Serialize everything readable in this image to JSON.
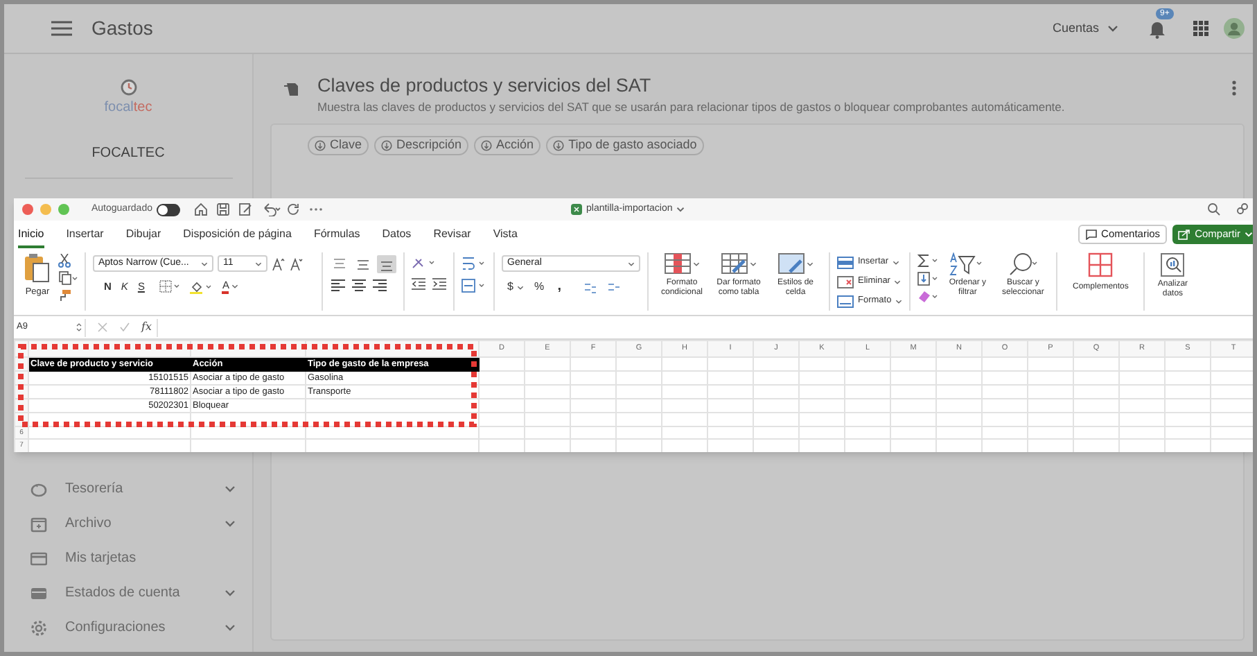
{
  "app": {
    "title": "Gastos",
    "account_menu": "Cuentas",
    "notification_badge": "9+"
  },
  "sidebar": {
    "logo_parts": [
      {
        "text": "focal",
        "color": "#7d8fae"
      },
      {
        "text": "tec",
        "color": "#c46a60"
      }
    ],
    "company": "FOCALTEC",
    "items": [
      {
        "label": "Tesorería",
        "expandable": true,
        "kind": "piggy"
      },
      {
        "label": "Archivo",
        "expandable": true,
        "kind": "archive"
      },
      {
        "label": "Mis tarjetas",
        "expandable": false,
        "kind": "card"
      },
      {
        "label": "Estados de cuenta",
        "expandable": true,
        "kind": "wallet"
      },
      {
        "label": "Configuraciones",
        "expandable": true,
        "kind": "gear"
      }
    ]
  },
  "page": {
    "title": "Claves de productos y servicios del SAT",
    "subtitle": "Muestra las claves de productos y servicios del SAT que se usarán para relacionar tipos de gastos o bloquear comprobantes automáticamente.",
    "filter_chips": [
      "Clave",
      "Descripción",
      "Acción",
      "Tipo de gasto asociado"
    ]
  },
  "excel": {
    "autosave_label": "Autoguardado",
    "autosave_on": false,
    "file_name": "plantilla-importacion",
    "tabs": [
      {
        "label": "Inicio",
        "selected": true
      },
      {
        "label": "Insertar",
        "selected": false
      },
      {
        "label": "Dibujar",
        "selected": false
      },
      {
        "label": "Disposición de página",
        "selected": false
      },
      {
        "label": "Fórmulas",
        "selected": false
      },
      {
        "label": "Datos",
        "selected": false
      },
      {
        "label": "Revisar",
        "selected": false
      },
      {
        "label": "Vista",
        "selected": false
      }
    ],
    "comments_button": "Comentarios",
    "share_button": "Compartir",
    "ribbon": {
      "paste": "Pegar",
      "font_name": "Aptos Narrow (Cue...",
      "font_size": "11",
      "bold": "N",
      "italic": "K",
      "underline": "S",
      "font_color": "A",
      "vertical_align": [
        {
          "selected": false
        },
        {
          "selected": false
        },
        {
          "selected": true
        }
      ],
      "number_format": "General",
      "currency": "$",
      "percent": "%",
      "comma": ",",
      "style_buttons": [
        "Formato condicional",
        "Dar formato como tabla",
        "Estilos de celda"
      ],
      "cell_buttons": [
        "Insertar",
        "Eliminar",
        "Formato"
      ],
      "sort_button": "Ordenar y filtrar",
      "find_button": "Buscar y seleccionar",
      "addins_button": "Complementos",
      "analyze_button": "Analizar datos"
    },
    "name_box": "A9",
    "fx": "fx",
    "sheet": {
      "columns": [
        "D",
        "E",
        "F",
        "G",
        "H",
        "I",
        "J",
        "K",
        "L",
        "M",
        "N",
        "O",
        "P",
        "Q",
        "R",
        "S",
        "T"
      ],
      "row_numbers": [
        "6",
        "7"
      ],
      "header": [
        "Clave de producto y servicio",
        "Acción",
        "Tipo de gasto de la empresa"
      ],
      "rows": [
        {
          "code": "15101515",
          "action": "Asociar a tipo de gasto",
          "expense_type": "Gasolina"
        },
        {
          "code": "78111802",
          "action": "Asociar a tipo de gasto",
          "expense_type": "Transporte"
        },
        {
          "code": "50202301",
          "action": "Bloquear"
        }
      ]
    }
  }
}
